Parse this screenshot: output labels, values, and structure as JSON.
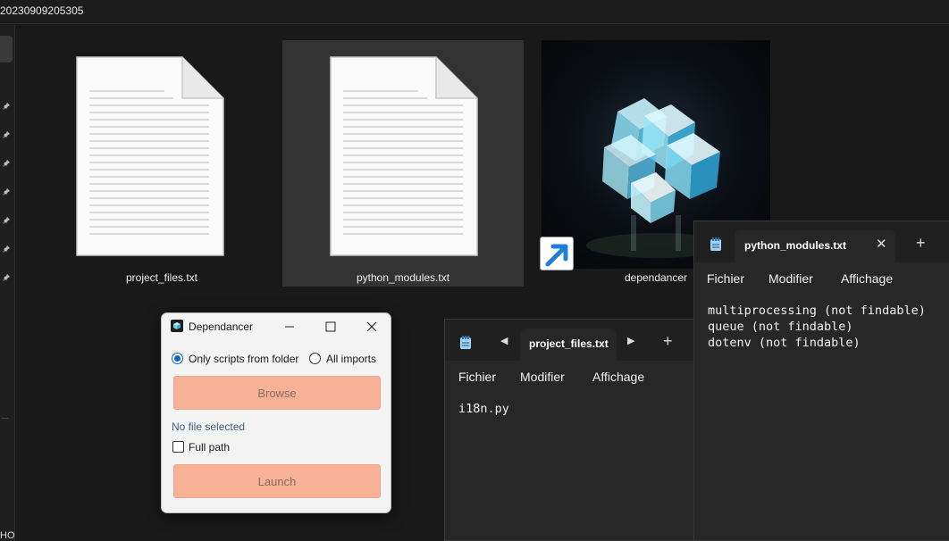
{
  "explorer": {
    "window_title": "20230909205305",
    "sidebar_footer": "HO",
    "files": [
      {
        "name": "project_files.txt",
        "icon": "text-file-icon"
      },
      {
        "name": "python_modules.txt",
        "icon": "text-file-icon"
      },
      {
        "name": "dependancer",
        "icon": "shortcut-app-icon"
      }
    ]
  },
  "notepad_project": {
    "tab_title": "project_files.txt",
    "menu": [
      "Fichier",
      "Modifier",
      "Affichage"
    ],
    "lines": [
      "i18n.py"
    ]
  },
  "notepad_modules": {
    "tab_title": "python_modules.txt",
    "menu": [
      "Fichier",
      "Modifier",
      "Affichage"
    ],
    "lines": [
      "multiprocessing (not findable)",
      "queue (not findable)",
      "dotenv (not findable)"
    ]
  },
  "dependancer": {
    "title": "Dependancer",
    "radio_folder": "Only scripts from folder",
    "radio_all": "All imports",
    "radio_selected": "folder",
    "browse_label": "Browse",
    "status": "No file selected",
    "fullpath_label": "Full path",
    "fullpath_checked": false,
    "launch_label": "Launch",
    "accent": "#f7b196"
  }
}
